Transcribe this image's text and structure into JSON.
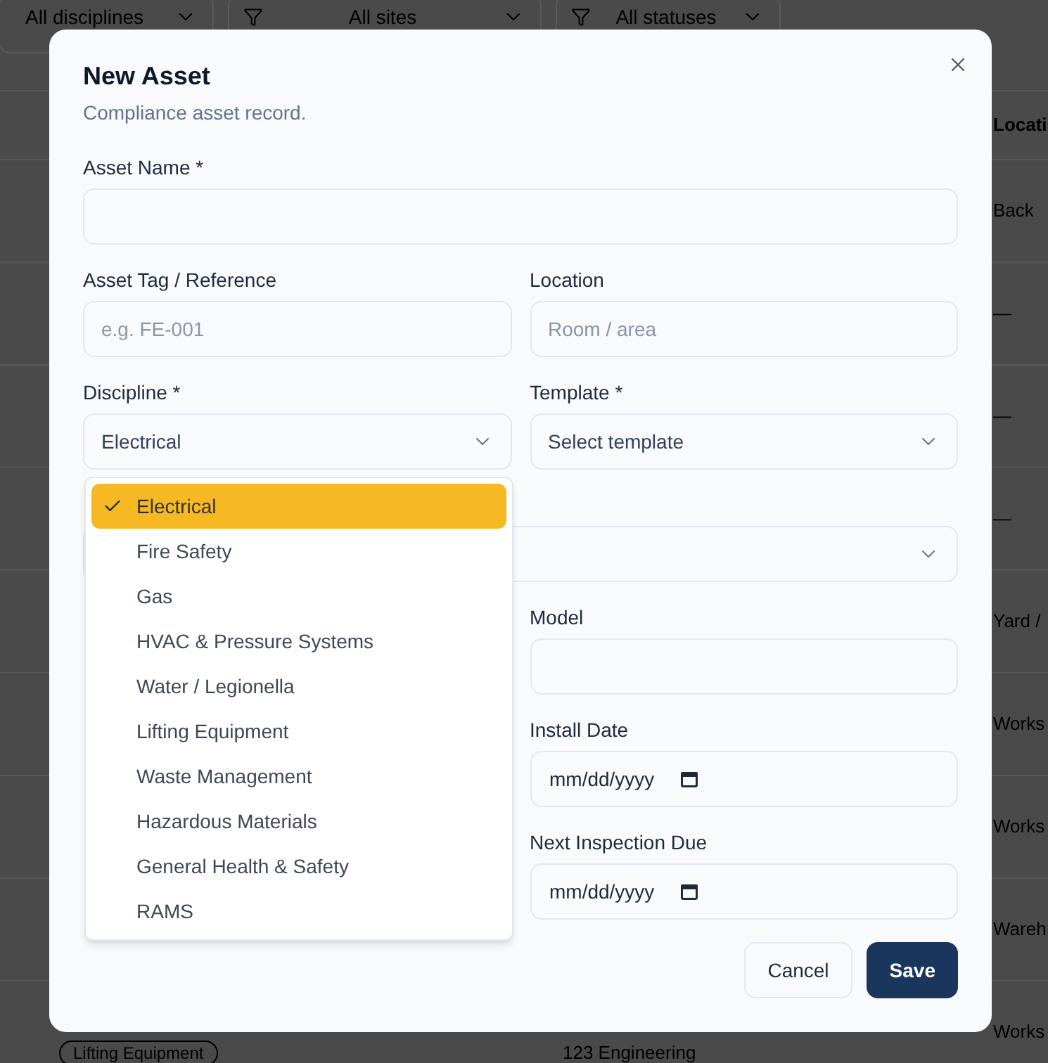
{
  "filters": [
    {
      "label": "All disciplines",
      "filter_icon": false
    },
    {
      "label": "All sites",
      "filter_icon": true
    },
    {
      "label": "All statuses",
      "filter_icon": true
    }
  ],
  "table": {
    "column_3_header": "Locati",
    "rows": [
      {
        "column_3": "Back"
      },
      {
        "column_3": "—"
      },
      {
        "column_3": "—"
      },
      {
        "column_3": "—"
      },
      {
        "column_3": "Yard /"
      },
      {
        "column_3": "Works"
      },
      {
        "column_3": "Works"
      },
      {
        "column_3": "Wareh"
      },
      {
        "column_1": "Lifting Equipment",
        "column_2": "123 Engineering",
        "column_3": "Works"
      }
    ]
  },
  "dialog": {
    "title": "New Asset",
    "subtitle": "Compliance asset record.",
    "rows": [
      {
        "full": {
          "kind": "text",
          "label": "Asset Name *"
        }
      },
      {
        "left": {
          "kind": "text",
          "label": "Asset Tag / Reference",
          "placeholder": "e.g. FE-001"
        },
        "right": {
          "kind": "text",
          "label": "Location",
          "placeholder": "Room / area"
        }
      },
      {
        "left": {
          "kind": "select",
          "label": "Discipline *",
          "value": "Electrical",
          "open": true,
          "options": [
            {
              "label": "Electrical",
              "selected": true
            },
            {
              "label": "Fire Safety",
              "selected": false
            },
            {
              "label": "Gas",
              "selected": false
            },
            {
              "label": "HVAC & Pressure Systems",
              "selected": false
            },
            {
              "label": "Water / Legionella",
              "selected": false
            },
            {
              "label": "Lifting Equipment",
              "selected": false
            },
            {
              "label": "Waste Management",
              "selected": false
            },
            {
              "label": "Hazardous Materials",
              "selected": false
            },
            {
              "label": "General Health & Safety",
              "selected": false
            },
            {
              "label": "RAMS",
              "selected": false
            }
          ]
        },
        "right": {
          "kind": "select",
          "label": "Template *",
          "placeholder": "Select template"
        }
      },
      {
        "full": {
          "kind": "select"
        }
      },
      {
        "right": {
          "kind": "text",
          "label": "Model"
        }
      },
      {
        "right": {
          "kind": "date",
          "label": "Install Date",
          "placeholder": "mm/dd/yyyy"
        }
      },
      {
        "right": {
          "kind": "date",
          "label": "Next Inspection Due",
          "placeholder": "mm/dd/yyyy"
        }
      }
    ],
    "buttons": [
      {
        "label": "Cancel",
        "kind": "secondary"
      },
      {
        "label": "Save",
        "kind": "primary"
      }
    ]
  }
}
